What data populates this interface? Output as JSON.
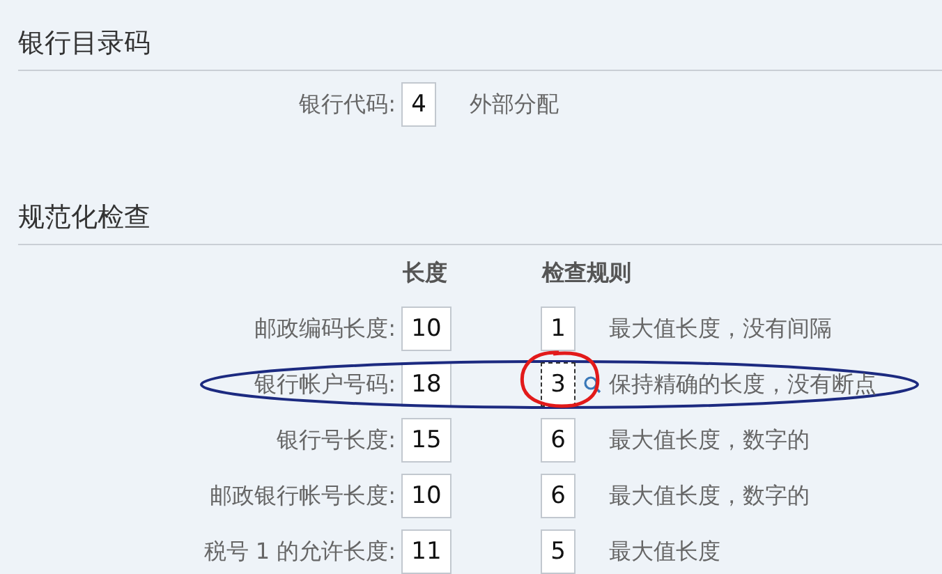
{
  "sections": [
    {
      "title": "银行目录码"
    },
    {
      "title": "规范化检查"
    }
  ],
  "bank_code": {
    "label": "银行代码:",
    "value": "4",
    "description": "外部分配"
  },
  "checks": {
    "columns": [
      "长度",
      "检查规则"
    ],
    "rows": [
      {
        "label": "邮政编码长度:",
        "length": "10",
        "rule": "1",
        "description": "最大值长度，没有间隔",
        "focused": false,
        "highlighted": false,
        "circled": false
      },
      {
        "label": "银行帐户号码:",
        "length": "18",
        "rule": "3",
        "description": "保持精确的长度，没有断点",
        "focused": true,
        "highlighted": true,
        "circled": true
      },
      {
        "label": "银行号长度:",
        "length": "15",
        "rule": "6",
        "description": "最大值长度，数字的",
        "focused": false,
        "highlighted": false,
        "circled": false
      },
      {
        "label": "邮政银行帐号长度:",
        "length": "10",
        "rule": "6",
        "description": "最大值长度，数字的",
        "focused": false,
        "highlighted": false,
        "circled": false
      },
      {
        "label": "税号 1 的允许长度:",
        "length": "11",
        "rule": "5",
        "description": "最大值长度",
        "focused": false,
        "highlighted": false,
        "circled": false
      }
    ]
  }
}
